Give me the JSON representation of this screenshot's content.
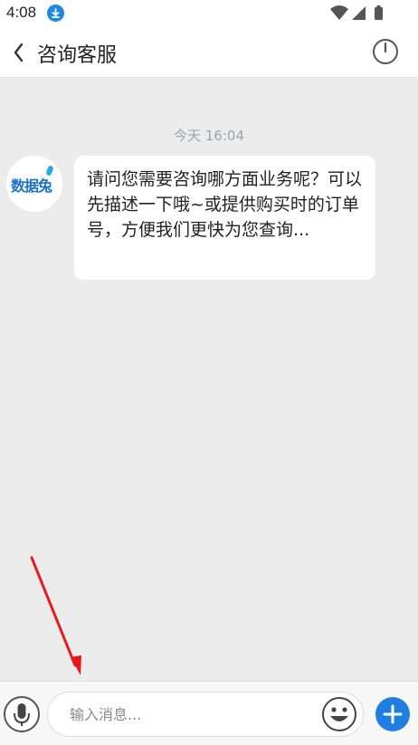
{
  "status_bar": {
    "time": "4:08",
    "icons": [
      "download-badge-icon",
      "wifi-icon",
      "signal-icon",
      "battery-icon"
    ]
  },
  "header": {
    "title": "咨询客服",
    "back_icon": "chevron-left-icon",
    "power_icon": "power-icon"
  },
  "chat": {
    "timestamp": "今天 16:04",
    "messages": [
      {
        "sender": "agent",
        "avatar_text": "数据兔",
        "text": "请问您需要咨询哪方面业务呢？可以先描述一下哦~或提供购买时的订单号，方便我们更快为您查询..."
      }
    ]
  },
  "input_bar": {
    "placeholder": "输入消息...",
    "value": "",
    "voice_icon": "microphone-icon",
    "emoji_icon": "smiley-icon",
    "plus_icon": "plus-icon"
  },
  "colors": {
    "accent": "#1e7fe0",
    "chat_background": "#ececec",
    "annotation_arrow": "#e8191c"
  }
}
